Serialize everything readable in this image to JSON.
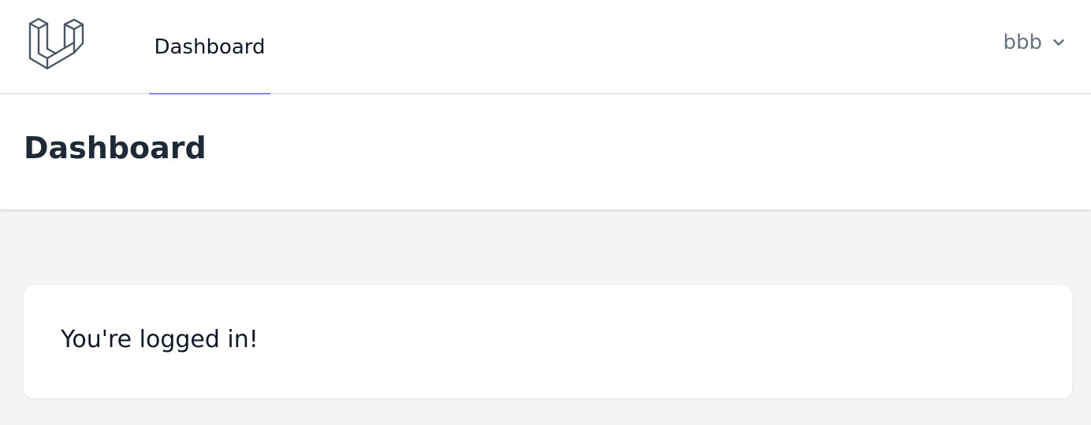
{
  "nav": {
    "logo_icon": "laravel-logo-icon",
    "links": [
      {
        "label": "Dashboard",
        "active": true
      }
    ],
    "user": {
      "name": "bbb",
      "dropdown_icon": "chevron-down-icon"
    }
  },
  "header": {
    "title": "Dashboard"
  },
  "main": {
    "message": "You're logged in!"
  },
  "colors": {
    "accent": "#818cf8",
    "background": "#f3f4f6",
    "surface": "#ffffff"
  }
}
